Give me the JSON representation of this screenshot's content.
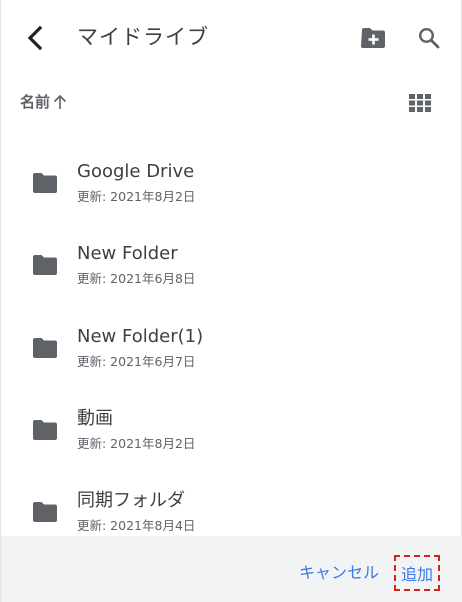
{
  "header": {
    "title": "マイドライブ",
    "back_icon": "chevron-left-icon",
    "new_folder_icon": "create-new-folder-icon",
    "search_icon": "search-icon"
  },
  "sort": {
    "label": "名前",
    "direction_icon": "arrow-up-icon",
    "view_toggle_icon": "grid-view-icon"
  },
  "files": [
    {
      "name": "Google Drive",
      "modified": "更新: 2021年8月2日",
      "icon": "folder-icon"
    },
    {
      "name": "New Folder",
      "modified": "更新: 2021年6月8日",
      "icon": "folder-icon"
    },
    {
      "name": "New Folder(1)",
      "modified": "更新: 2021年6月7日",
      "icon": "folder-icon"
    },
    {
      "name": "動画",
      "modified": "更新: 2021年8月2日",
      "icon": "folder-icon"
    },
    {
      "name": "同期フォルダ",
      "modified": "更新: 2021年8月4日",
      "icon": "folder-icon"
    }
  ],
  "footer": {
    "cancel_label": "キャンセル",
    "add_label": "追加"
  },
  "colors": {
    "accent": "#3b78e7",
    "highlight_border": "#d6221a",
    "icon": "#5f6368",
    "footer_bg": "#f1f3f4"
  }
}
